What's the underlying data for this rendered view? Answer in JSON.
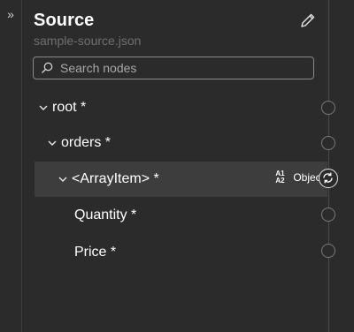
{
  "panel": {
    "title": "Source",
    "filename": "sample-source.json",
    "search_placeholder": "Search nodes",
    "edit_icon": "pencil-icon",
    "collapse_icon": "double-chevron-right-icon"
  },
  "tree": [
    {
      "label": "root *",
      "level": 0,
      "expanded": true
    },
    {
      "label": "orders *",
      "level": 1,
      "expanded": true
    },
    {
      "label": "<ArrayItem> *",
      "level": 2,
      "expanded": true,
      "selected": true,
      "type_label": "Object",
      "type_icon_text": "A1 A2"
    },
    {
      "label": "Quantity *",
      "level": 3
    },
    {
      "label": "Price *",
      "level": 3
    }
  ],
  "colors": {
    "background": "#2b2b2b",
    "selected_row": "#3d3d3d",
    "text": "#ffffff",
    "muted": "#6f6f6f"
  }
}
